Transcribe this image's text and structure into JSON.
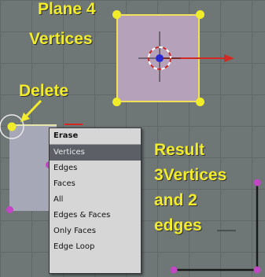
{
  "annotations": {
    "plane4": "Plane 4",
    "vertices": "Vertices",
    "delete": "Delete",
    "result_line1": "Result",
    "result_line2": "3Vertices",
    "result_line3": "and 2",
    "result_line4": "edges"
  },
  "menu": {
    "title": "Erase",
    "items": [
      {
        "label": "Vertices",
        "active": true
      },
      {
        "label": "Edges",
        "active": false
      },
      {
        "label": "Faces",
        "active": false
      },
      {
        "label": "All",
        "active": false
      },
      {
        "label": "Edges & Faces",
        "active": false
      },
      {
        "label": "Only Faces",
        "active": false
      },
      {
        "label": "Edge Loop",
        "active": false
      }
    ]
  },
  "colors": {
    "annotation_yellow": "#f2ec2c",
    "selected_vertex": "#f0ec2a",
    "unselected_vertex": "#c247c4",
    "plane_face": "#b6a1bb",
    "menu_highlight": "#5c5f66",
    "background": "#6f7676"
  },
  "icons": [
    "transform-manipulator-icon",
    "cursor-3d-icon"
  ]
}
